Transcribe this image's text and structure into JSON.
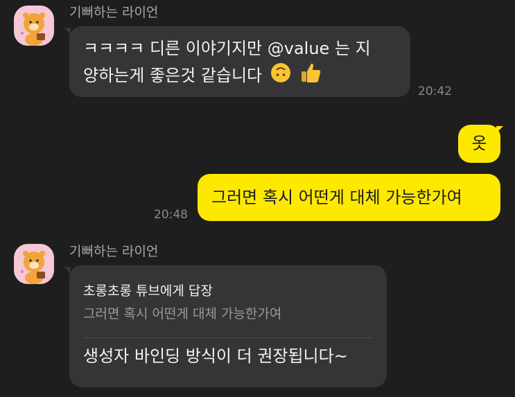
{
  "messages": {
    "first": {
      "sender": "기뻐하는 라이언",
      "line1": "ㅋㅋㅋㅋ 디른 이야기지만 @value 는 지",
      "line2": "양하는게 좋은것 같습니다",
      "emojis": [
        "upside-down-face-icon",
        "thumbs-up-icon"
      ],
      "time": "20:42"
    },
    "reply_ok": {
      "text": "옷"
    },
    "question": {
      "text": "그러면 혹시 어떤게 대체 가능한가여",
      "time": "20:48"
    },
    "second": {
      "sender": "기뻐하는 라이언",
      "reply_to": "초롱초롱 튜브에게 답장",
      "quote": "그러면 혹시 어떤게 대체 가능한가여",
      "text": "생성자 바인딩 방식이 더 권장됩니다~"
    }
  },
  "colors": {
    "background": "#1e1e1f",
    "incoming_bubble": "#353537",
    "outgoing_bubble": "#fde900",
    "avatar_bg": "#f6c7d4"
  }
}
